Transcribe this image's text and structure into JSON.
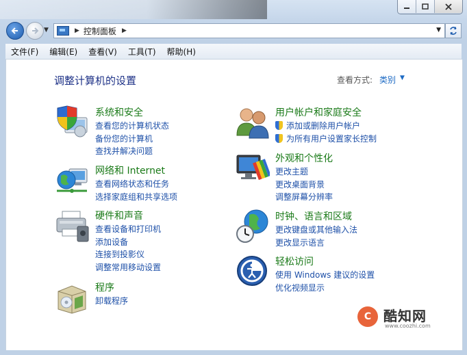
{
  "window": {
    "caption_buttons": [
      "minimize",
      "maximize",
      "close"
    ]
  },
  "address_bar": {
    "breadcrumb": "控制面板"
  },
  "menu": [
    "文件(F)",
    "编辑(E)",
    "查看(V)",
    "工具(T)",
    "帮助(H)"
  ],
  "content": {
    "title": "调整计算机的设置",
    "view_label": "查看方式:",
    "view_value": "类别"
  },
  "categories": [
    {
      "id": "system-security",
      "icon": "shield-computer-icon",
      "title": "系统和安全",
      "links": [
        "查看您的计算机状态",
        "备份您的计算机",
        "查找并解决问题"
      ]
    },
    {
      "id": "network-internet",
      "icon": "globe-network-icon",
      "title": "网络和 Internet",
      "links": [
        "查看网络状态和任务",
        "选择家庭组和共享选项"
      ]
    },
    {
      "id": "hardware-sound",
      "icon": "printer-icon",
      "title": "硬件和声音",
      "links": [
        "查看设备和打印机",
        "添加设备",
        "连接到投影仪",
        "调整常用移动设置"
      ]
    },
    {
      "id": "programs",
      "icon": "program-box-icon",
      "title": "程序",
      "links": [
        "卸载程序"
      ]
    },
    {
      "id": "user-accounts",
      "icon": "users-icon",
      "title": "用户帐户和家庭安全",
      "links": [
        "添加或删除用户帐户",
        "为所有用户设置家长控制"
      ],
      "shielded": true
    },
    {
      "id": "appearance",
      "icon": "display-palette-icon",
      "title": "外观和个性化",
      "links": [
        "更改主题",
        "更改桌面背景",
        "调整屏幕分辨率"
      ]
    },
    {
      "id": "clock-region",
      "icon": "clock-globe-icon",
      "title": "时钟、语言和区域",
      "links": [
        "更改键盘或其他输入法",
        "更改显示语言"
      ]
    },
    {
      "id": "ease-of-access",
      "icon": "ease-of-access-icon",
      "title": "轻松访问",
      "links": [
        "使用 Windows 建议的设置",
        "优化视频显示"
      ]
    }
  ],
  "watermark": {
    "brand": "酷知网",
    "url": "www.coozhi.com",
    "logo_letter": "C"
  }
}
